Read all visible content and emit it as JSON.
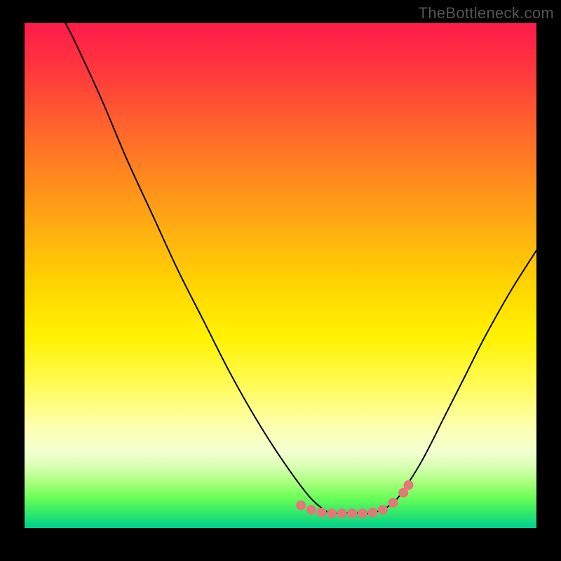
{
  "watermark": "TheBottleneck.com",
  "chart_data": {
    "type": "line",
    "title": "",
    "xlabel": "",
    "ylabel": "",
    "xlim": [
      0,
      10
    ],
    "ylim": [
      0,
      100
    ],
    "series": [
      {
        "name": "curve",
        "x": [
          0.8,
          1.0,
          1.5,
          2.0,
          2.5,
          3.0,
          3.5,
          4.0,
          4.5,
          5.0,
          5.5,
          5.8,
          6.0,
          6.4,
          6.8,
          7.2,
          7.5,
          7.8,
          8.2,
          8.6,
          9.0,
          9.5,
          10.0
        ],
        "values": [
          100,
          96,
          85,
          73,
          62,
          51,
          41,
          31,
          22,
          14,
          7,
          4,
          3,
          3,
          3,
          5,
          9,
          14,
          22,
          30,
          38,
          47,
          55
        ]
      }
    ],
    "markers": {
      "name": "pink-dots",
      "color": "#e27878",
      "x": [
        5.4,
        5.6,
        5.8,
        6.0,
        6.2,
        6.4,
        6.6,
        6.8,
        7.0,
        7.2,
        7.4,
        7.5
      ],
      "values": [
        4.5,
        3.6,
        3.1,
        2.9,
        2.9,
        2.9,
        2.9,
        3.1,
        3.6,
        5.0,
        7.0,
        8.5
      ]
    }
  }
}
